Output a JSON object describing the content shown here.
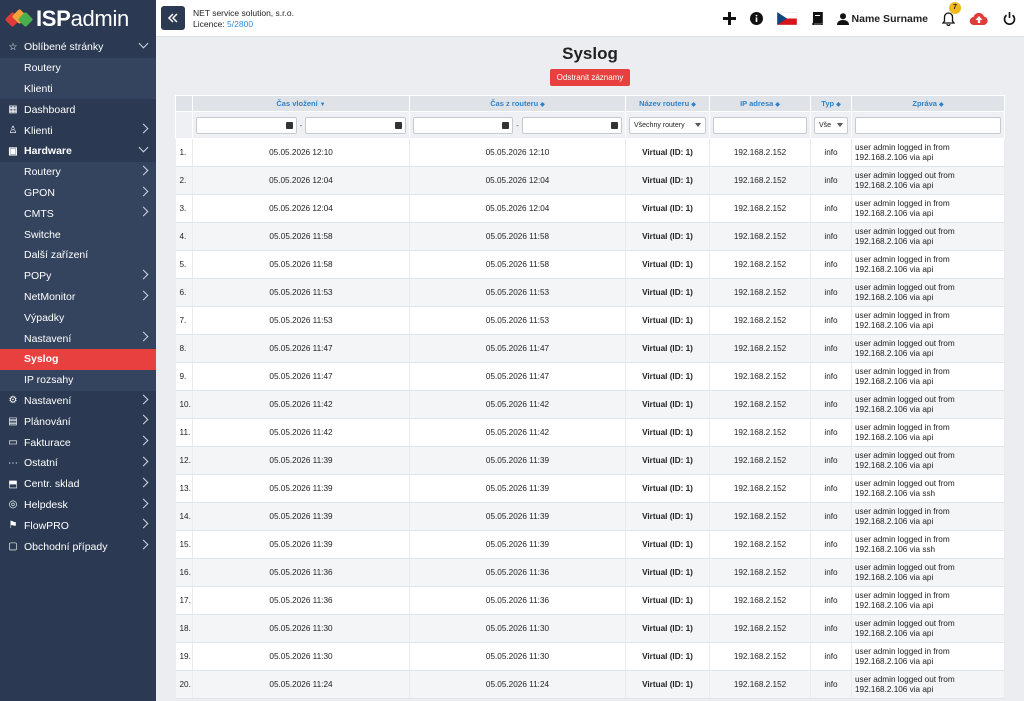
{
  "logo": {
    "text_bold": "ISP",
    "text_light": "admin"
  },
  "header": {
    "company": "NET service solution, s.r.o.",
    "licence_label": "Licence:",
    "licence_value": "5/2800",
    "user_name": "Name Surname",
    "notifications_count": "7",
    "icons": [
      "plus-icon",
      "info-icon",
      "flag-cz-icon",
      "book-icon",
      "user-icon",
      "bell-icon",
      "cloud-upload-icon",
      "power-icon"
    ]
  },
  "sidebar": {
    "items": [
      {
        "label": "Oblíbené stránky",
        "icon": "star",
        "chevron": "down"
      },
      {
        "label": "Routery",
        "sub": true
      },
      {
        "label": "Klienti",
        "sub": true
      },
      {
        "label": "Dashboard",
        "icon": "grid"
      },
      {
        "label": "Klienti",
        "icon": "user",
        "chevron": "right"
      },
      {
        "label": "Hardware",
        "icon": "chip",
        "chevron": "down",
        "bold": true
      },
      {
        "label": "Routery",
        "sub": true,
        "chevron": "right"
      },
      {
        "label": "GPON",
        "sub": true,
        "chevron": "right"
      },
      {
        "label": "CMTS",
        "sub": true,
        "chevron": "right"
      },
      {
        "label": "Switche",
        "sub": true
      },
      {
        "label": "Další zařízení",
        "sub": true
      },
      {
        "label": "POPy",
        "sub": true,
        "chevron": "right"
      },
      {
        "label": "NetMonitor",
        "sub": true,
        "chevron": "right"
      },
      {
        "label": "Výpadky",
        "sub": true
      },
      {
        "label": "Nastavení",
        "sub": true,
        "chevron": "right"
      },
      {
        "label": "Syslog",
        "sub": true,
        "active": true
      },
      {
        "label": "IP rozsahy",
        "sub": true
      },
      {
        "label": "Nastavení",
        "icon": "gear",
        "chevron": "right"
      },
      {
        "label": "Plánování",
        "icon": "calendar",
        "chevron": "right"
      },
      {
        "label": "Fakturace",
        "icon": "invoice",
        "chevron": "right"
      },
      {
        "label": "Ostatní",
        "icon": "dots",
        "chevron": "right"
      },
      {
        "label": "Centr. sklad",
        "icon": "box",
        "chevron": "right"
      },
      {
        "label": "Helpdesk",
        "icon": "globe",
        "chevron": "right"
      },
      {
        "label": "FlowPRO",
        "icon": "flow",
        "chevron": "right"
      },
      {
        "label": "Obchodní případy",
        "icon": "briefcase",
        "chevron": "right"
      }
    ]
  },
  "main": {
    "title": "Syslog",
    "delete_button": "Odstranit záznamy",
    "columns": [
      "Čas vložení",
      "Čas z routeru",
      "Název routeru",
      "IP adresa",
      "Typ",
      "Zpráva"
    ],
    "filters": {
      "router_select": "Všechny routery",
      "type_select": "Vše"
    },
    "rows": [
      {
        "n": "1.",
        "t1": "05.05.2026 12:10",
        "t2": "05.05.2026 12:10",
        "router": "Virtual (ID: 1)",
        "ip": "192.168.2.152",
        "type": "info",
        "msg1": "user admin logged in from",
        "msg2": "192.168.2.106 via api"
      },
      {
        "n": "2.",
        "t1": "05.05.2026 12:04",
        "t2": "05.05.2026 12:04",
        "router": "Virtual (ID: 1)",
        "ip": "192.168.2.152",
        "type": "info",
        "msg1": "user admin logged out from",
        "msg2": "192.168.2.106 via api"
      },
      {
        "n": "3.",
        "t1": "05.05.2026 12:04",
        "t2": "05.05.2026 12:04",
        "router": "Virtual (ID: 1)",
        "ip": "192.168.2.152",
        "type": "info",
        "msg1": "user admin logged in from",
        "msg2": "192.168.2.106 via api"
      },
      {
        "n": "4.",
        "t1": "05.05.2026 11:58",
        "t2": "05.05.2026 11:58",
        "router": "Virtual (ID: 1)",
        "ip": "192.168.2.152",
        "type": "info",
        "msg1": "user admin logged out from",
        "msg2": "192.168.2.106 via api"
      },
      {
        "n": "5.",
        "t1": "05.05.2026 11:58",
        "t2": "05.05.2026 11:58",
        "router": "Virtual (ID: 1)",
        "ip": "192.168.2.152",
        "type": "info",
        "msg1": "user admin logged in from",
        "msg2": "192.168.2.106 via api"
      },
      {
        "n": "6.",
        "t1": "05.05.2026 11:53",
        "t2": "05.05.2026 11:53",
        "router": "Virtual (ID: 1)",
        "ip": "192.168.2.152",
        "type": "info",
        "msg1": "user admin logged out from",
        "msg2": "192.168.2.106 via api"
      },
      {
        "n": "7.",
        "t1": "05.05.2026 11:53",
        "t2": "05.05.2026 11:53",
        "router": "Virtual (ID: 1)",
        "ip": "192.168.2.152",
        "type": "info",
        "msg1": "user admin logged in from",
        "msg2": "192.168.2.106 via api"
      },
      {
        "n": "8.",
        "t1": "05.05.2026 11:47",
        "t2": "05.05.2026 11:47",
        "router": "Virtual (ID: 1)",
        "ip": "192.168.2.152",
        "type": "info",
        "msg1": "user admin logged out from",
        "msg2": "192.168.2.106 via api"
      },
      {
        "n": "9.",
        "t1": "05.05.2026 11:47",
        "t2": "05.05.2026 11:47",
        "router": "Virtual (ID: 1)",
        "ip": "192.168.2.152",
        "type": "info",
        "msg1": "user admin logged in from",
        "msg2": "192.168.2.106 via api"
      },
      {
        "n": "10.",
        "t1": "05.05.2026 11:42",
        "t2": "05.05.2026 11:42",
        "router": "Virtual (ID: 1)",
        "ip": "192.168.2.152",
        "type": "info",
        "msg1": "user admin logged out from",
        "msg2": "192.168.2.106 via api"
      },
      {
        "n": "11.",
        "t1": "05.05.2026 11:42",
        "t2": "05.05.2026 11:42",
        "router": "Virtual (ID: 1)",
        "ip": "192.168.2.152",
        "type": "info",
        "msg1": "user admin logged in from",
        "msg2": "192.168.2.106 via api"
      },
      {
        "n": "12.",
        "t1": "05.05.2026 11:39",
        "t2": "05.05.2026 11:39",
        "router": "Virtual (ID: 1)",
        "ip": "192.168.2.152",
        "type": "info",
        "msg1": "user admin logged out from",
        "msg2": "192.168.2.106 via api"
      },
      {
        "n": "13.",
        "t1": "05.05.2026 11:39",
        "t2": "05.05.2026 11:39",
        "router": "Virtual (ID: 1)",
        "ip": "192.168.2.152",
        "type": "info",
        "msg1": "user admin logged out from",
        "msg2": "192.168.2.106 via ssh"
      },
      {
        "n": "14.",
        "t1": "05.05.2026 11:39",
        "t2": "05.05.2026 11:39",
        "router": "Virtual (ID: 1)",
        "ip": "192.168.2.152",
        "type": "info",
        "msg1": "user admin logged in from",
        "msg2": "192.168.2.106 via api"
      },
      {
        "n": "15.",
        "t1": "05.05.2026 11:39",
        "t2": "05.05.2026 11:39",
        "router": "Virtual (ID: 1)",
        "ip": "192.168.2.152",
        "type": "info",
        "msg1": "user admin logged in from",
        "msg2": "192.168.2.106 via ssh"
      },
      {
        "n": "16.",
        "t1": "05.05.2026 11:36",
        "t2": "05.05.2026 11:36",
        "router": "Virtual (ID: 1)",
        "ip": "192.168.2.152",
        "type": "info",
        "msg1": "user admin logged out from",
        "msg2": "192.168.2.106 via api"
      },
      {
        "n": "17.",
        "t1": "05.05.2026 11:36",
        "t2": "05.05.2026 11:36",
        "router": "Virtual (ID: 1)",
        "ip": "192.168.2.152",
        "type": "info",
        "msg1": "user admin logged in from",
        "msg2": "192.168.2.106 via api"
      },
      {
        "n": "18.",
        "t1": "05.05.2026 11:30",
        "t2": "05.05.2026 11:30",
        "router": "Virtual (ID: 1)",
        "ip": "192.168.2.152",
        "type": "info",
        "msg1": "user admin logged out from",
        "msg2": "192.168.2.106 via api"
      },
      {
        "n": "19.",
        "t1": "05.05.2026 11:30",
        "t2": "05.05.2026 11:30",
        "router": "Virtual (ID: 1)",
        "ip": "192.168.2.152",
        "type": "info",
        "msg1": "user admin logged in from",
        "msg2": "192.168.2.106 via api"
      },
      {
        "n": "20.",
        "t1": "05.05.2026 11:24",
        "t2": "05.05.2026 11:24",
        "router": "Virtual (ID: 1)",
        "ip": "192.168.2.152",
        "type": "info",
        "msg1": "user admin logged out from",
        "msg2": "192.168.2.106 via api"
      }
    ]
  },
  "colors": {
    "sidebar": "#2b3a52",
    "active": "#e8403f",
    "link": "#2f82c9"
  }
}
